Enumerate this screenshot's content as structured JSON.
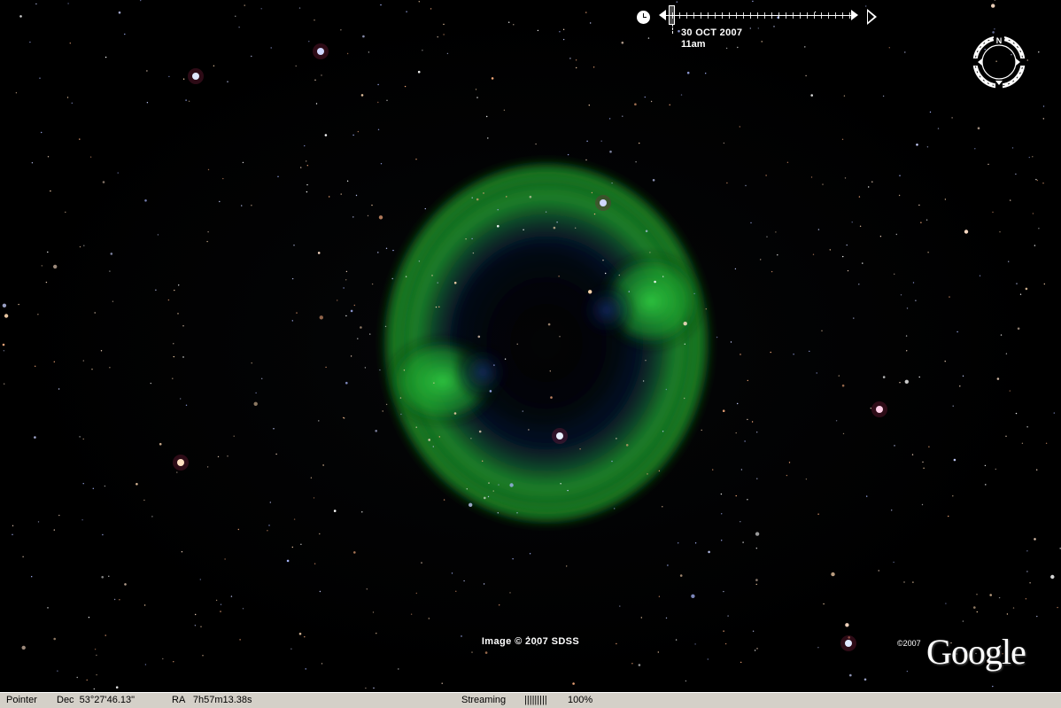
{
  "view": {
    "time_slider": {
      "date": "30 OCT 2007",
      "time": "11am"
    },
    "compass": {
      "north_label": "N"
    },
    "attribution": "Image © 2007 SDSS",
    "logo": {
      "copyright": "©2007",
      "text": "Google"
    }
  },
  "statusbar": {
    "pointer_label": "Pointer",
    "dec": "Dec  53°27'46.13\"",
    "ra": "RA   7h57m13.38s",
    "streaming_label": "Streaming",
    "streaming_bars": "|||||||||",
    "streaming_percent": "100%"
  },
  "colors": {
    "nebula": "#1fa830",
    "nebula_core": "#0a2a6a",
    "sky": "#000000",
    "statusbar": "#d4d0c8"
  },
  "icons": [
    "clock-icon",
    "compass-ring-icon",
    "play-icon",
    "slider-arrow-icon"
  ]
}
